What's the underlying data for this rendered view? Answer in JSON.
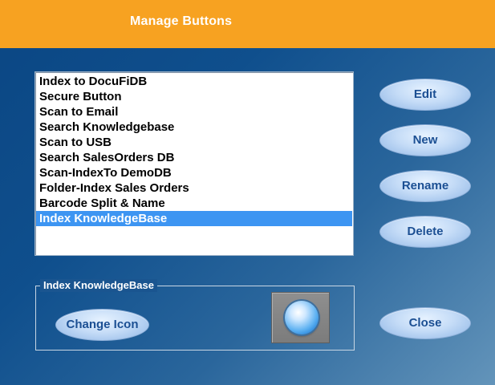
{
  "header": {
    "title": "Manage Buttons"
  },
  "buttons_list": {
    "items": [
      {
        "label": "Index to DocuFiDB"
      },
      {
        "label": "Secure Button"
      },
      {
        "label": "Scan to Email"
      },
      {
        "label": "Search Knowledgebase"
      },
      {
        "label": "Scan to USB"
      },
      {
        "label": "Search SalesOrders DB"
      },
      {
        "label": "Scan-IndexTo DemoDB"
      },
      {
        "label": "Folder-Index Sales Orders"
      },
      {
        "label": "Barcode Split & Name"
      },
      {
        "label": "Index KnowledgeBase"
      }
    ],
    "selected_index": 9
  },
  "actions": {
    "edit_label": "Edit",
    "new_label": "New",
    "rename_label": "Rename",
    "delete_label": "Delete",
    "close_label": "Close"
  },
  "selected_group": {
    "legend": "Index KnowledgeBase",
    "change_icon_label": "Change Icon",
    "icon": "blue-orb-icon"
  },
  "colors": {
    "header": "#f7a221",
    "selection": "#3d95f2",
    "button_text": "#1b4f93"
  }
}
